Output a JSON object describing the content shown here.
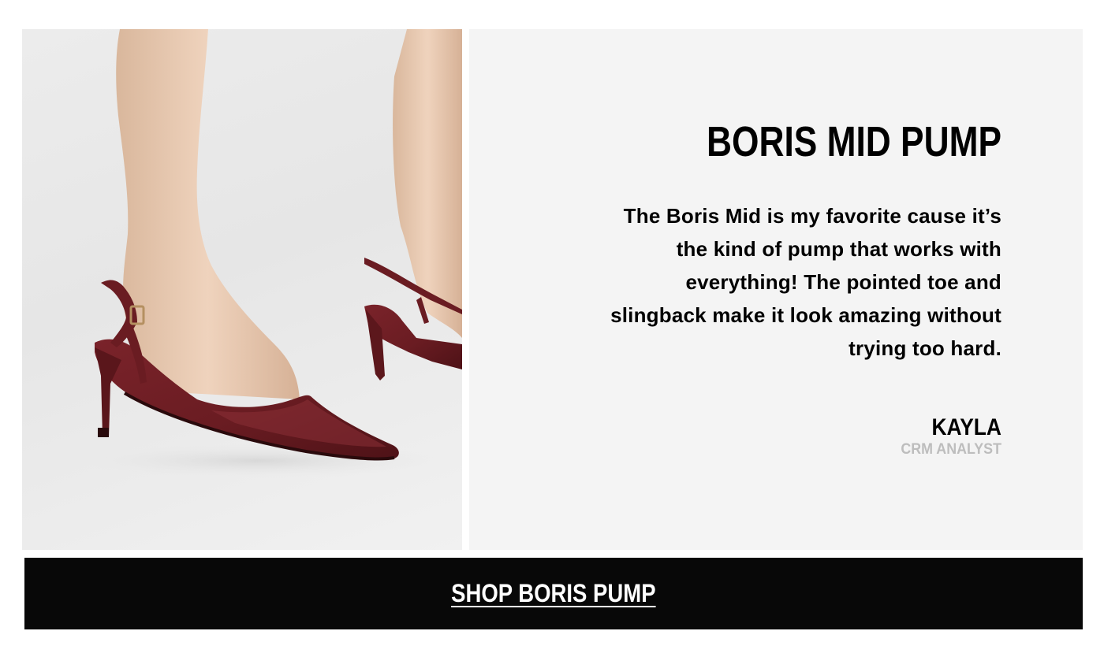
{
  "product": {
    "title": "BORIS MID PUMP",
    "image_alt": "Burgundy leather pointed-toe slingback mid heel pump worn on foot",
    "shoe_color": "#6d1f24"
  },
  "testimonial": {
    "quote": "The Boris Mid is my favorite cause it’s the kind of pump that works with everything! The pointed toe and slingback make it look amazing without trying too hard.",
    "author_name": "KAYLA",
    "author_role": "CRM ANALYST"
  },
  "cta": {
    "label": "SHOP BORIS PUMP"
  },
  "colors": {
    "panel_background": "#f4f4f4",
    "cta_background": "#080808",
    "cta_text": "#ffffff",
    "role_text": "#bdbdbd"
  }
}
